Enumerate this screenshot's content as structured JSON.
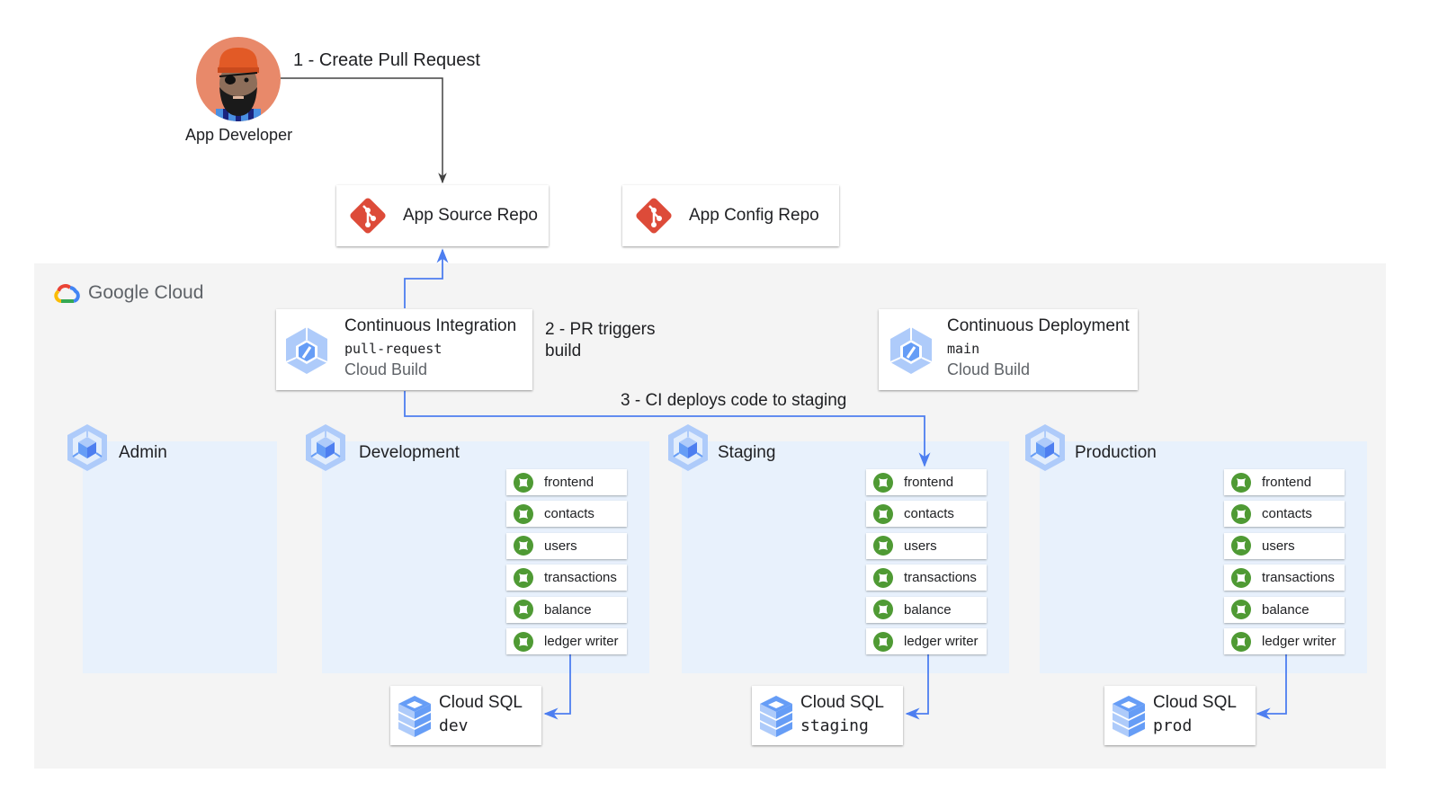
{
  "actor": {
    "name": "App Developer",
    "icon": "developer-avatar"
  },
  "steps": {
    "step1": "1 - Create Pull Request",
    "step2_line1": "2 - PR triggers",
    "step2_line2": "build",
    "step3": "3 - CI deploys code to staging"
  },
  "repos": [
    {
      "label": "App Source Repo",
      "icon": "git-icon"
    },
    {
      "label": "App Config Repo",
      "icon": "git-icon"
    }
  ],
  "platform": {
    "name": "Google Cloud",
    "icon": "google-cloud-logo"
  },
  "pipelines": {
    "ci": {
      "title": "Continuous Integration",
      "trigger": "pull-request",
      "product": "Cloud Build",
      "icon": "cloud-build-icon"
    },
    "cd": {
      "title": "Continuous Deployment",
      "trigger": "main",
      "product": "Cloud Build",
      "icon": "cloud-build-icon"
    }
  },
  "environments": [
    {
      "name": "Admin",
      "icon": "gke-icon",
      "services": []
    },
    {
      "name": "Development",
      "icon": "gke-icon",
      "services": [
        "frontend",
        "contacts",
        "users",
        "transactions",
        "balance",
        "ledger writer"
      ],
      "database": {
        "product": "Cloud SQL",
        "instance": "dev"
      }
    },
    {
      "name": "Staging",
      "icon": "gke-icon",
      "services": [
        "frontend",
        "contacts",
        "users",
        "transactions",
        "balance",
        "ledger writer"
      ],
      "database": {
        "product": "Cloud SQL",
        "instance": "staging"
      }
    },
    {
      "name": "Production",
      "icon": "gke-icon",
      "services": [
        "frontend",
        "contacts",
        "users",
        "transactions",
        "balance",
        "ledger writer"
      ],
      "database": {
        "product": "Cloud SQL",
        "instance": "prod"
      }
    }
  ],
  "colors": {
    "git": "#dd4b39",
    "gcp_panel": "#f4f4f4",
    "env_bg": "#e8f1fc",
    "service_icon": "#4f9a34",
    "connector_blue": "#4d7ef0",
    "connector_gray": "#424242",
    "gcp_icon_light": "#aecbfa",
    "gcp_icon_dark": "#669df6"
  }
}
